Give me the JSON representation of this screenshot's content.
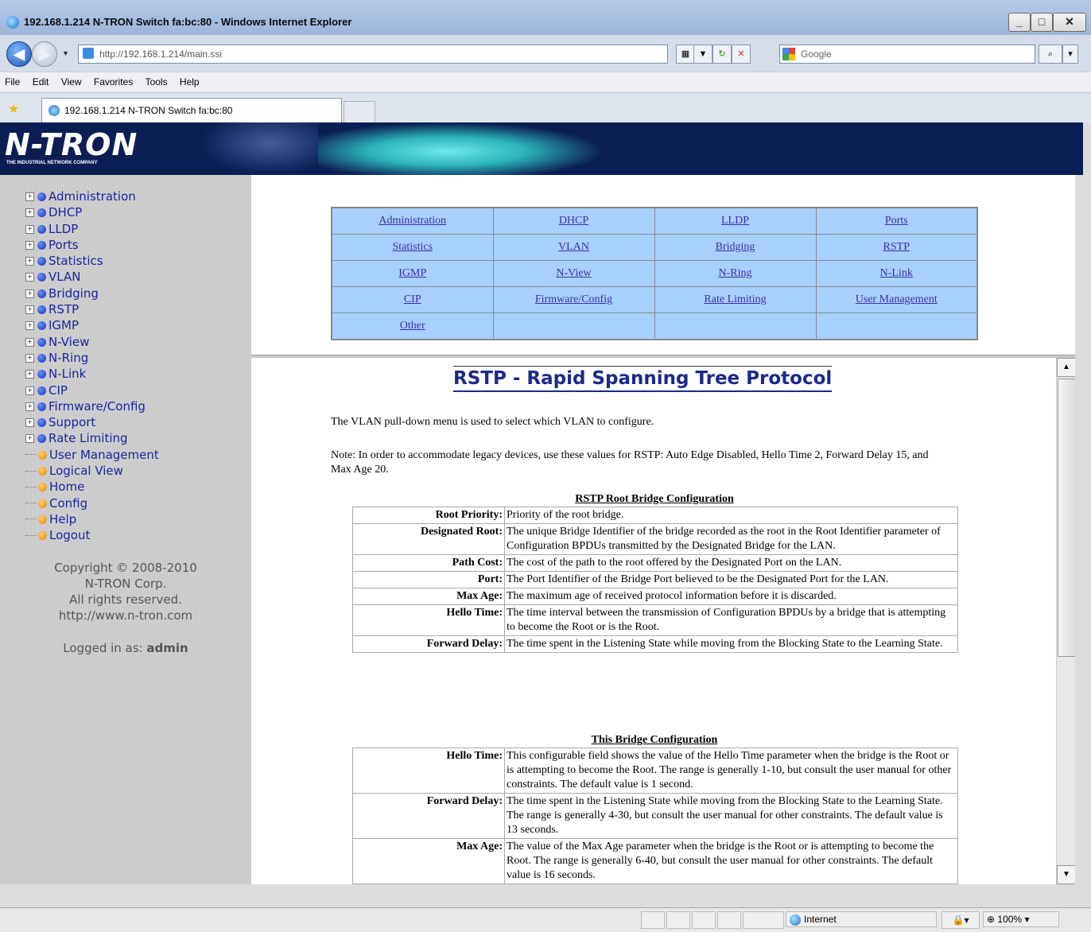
{
  "window": {
    "title": "192.168.1.214 N-TRON Switch fa:bc:80 - Windows Internet Explorer"
  },
  "browser": {
    "url": "http://192.168.1.214/main.ssi",
    "search_placeholder": "Google",
    "menu": [
      "File",
      "Edit",
      "View",
      "Favorites",
      "Tools",
      "Help"
    ],
    "tab_title": "192.168.1.214 N-TRON Switch fa:bc:80",
    "zone": "Internet",
    "zoom": "100%"
  },
  "banner": {
    "logo": "N-TRON",
    "tagline": "THE INDUSTRIAL NETWORK COMPANY"
  },
  "sidebar": {
    "expandable": [
      "Administration",
      "DHCP",
      "LLDP",
      "Ports",
      "Statistics",
      "VLAN",
      "Bridging",
      "RSTP",
      "IGMP",
      "N-View",
      "N-Ring",
      "N-Link",
      "CIP",
      "Firmware/Config",
      "Support",
      "Rate Limiting"
    ],
    "pages": [
      "User Management",
      "Logical View",
      "Home",
      "Config",
      "Help",
      "Logout"
    ],
    "copyright": [
      "Copyright © 2008-2010",
      "N-TRON Corp.",
      "All rights reserved.",
      "http://www.n-tron.com"
    ],
    "logged_in_label": "Logged in as:",
    "logged_in_user": "admin"
  },
  "navgrid": [
    [
      "Administration",
      "DHCP",
      "LLDP",
      "Ports"
    ],
    [
      "Statistics",
      "VLAN",
      "Bridging",
      "RSTP"
    ],
    [
      "IGMP",
      "N-View",
      "N-Ring",
      "N-Link"
    ],
    [
      "CIP",
      "Firmware/Config",
      "Rate Limiting",
      "User Management"
    ],
    [
      "Other",
      "",
      "",
      ""
    ]
  ],
  "content": {
    "title": "RSTP - Rapid Spanning Tree Protocol",
    "intro": "The VLAN pull-down menu is used to select which VLAN to configure.",
    "note": "Note: In order to accommodate legacy devices, use these values for RSTP: Auto Edge Disabled, Hello Time 2, Forward Delay 15, and Max Age 20.",
    "root_caption": "RSTP Root Bridge Configuration",
    "root_rows": [
      {
        "key": "Root Priority:",
        "val": "Priority of the root bridge."
      },
      {
        "key": "Designated Root:",
        "val": "The unique Bridge Identifier of the bridge recorded as the root in the Root Identifier parameter of Configuration BPDUs transmitted by the Designated Bridge for the LAN."
      },
      {
        "key": "Path Cost:",
        "val": "The cost of the path to the root offered by the Designated Port on the LAN."
      },
      {
        "key": "Port:",
        "val": "The Port Identifier of the Bridge Port believed to be the Designated Port for the LAN."
      },
      {
        "key": "Max Age:",
        "val": "The maximum age of received protocol information before it is discarded."
      },
      {
        "key": "Hello Time:",
        "val": "The time interval between the transmission of Configuration BPDUs by a bridge that is attempting to become the Root or is the Root."
      },
      {
        "key": "Forward Delay:",
        "val": "The time spent in the Listening State while moving from the Blocking State to the Learning State."
      }
    ],
    "bridge_caption": "This Bridge Configuration",
    "bridge_rows": [
      {
        "key": "Hello Time:",
        "val": "This configurable field shows the value of the Hello Time parameter when the bridge is the Root or is attempting to become the Root. The range is generally 1-10, but consult the user manual for other constraints. The default value is 1 second."
      },
      {
        "key": "Forward Delay:",
        "val": "The time spent in the Listening State while moving from the Blocking State to the Learning State. The range is generally 4-30, but consult the user manual for other constraints. The default value is 13 seconds."
      },
      {
        "key": "Max Age:",
        "val": "The value of the Max Age parameter when the bridge is the Root or is attempting to become the Root. The range is generally 6-40, but consult the user manual for other constraints. The default value is 16 seconds."
      }
    ]
  }
}
